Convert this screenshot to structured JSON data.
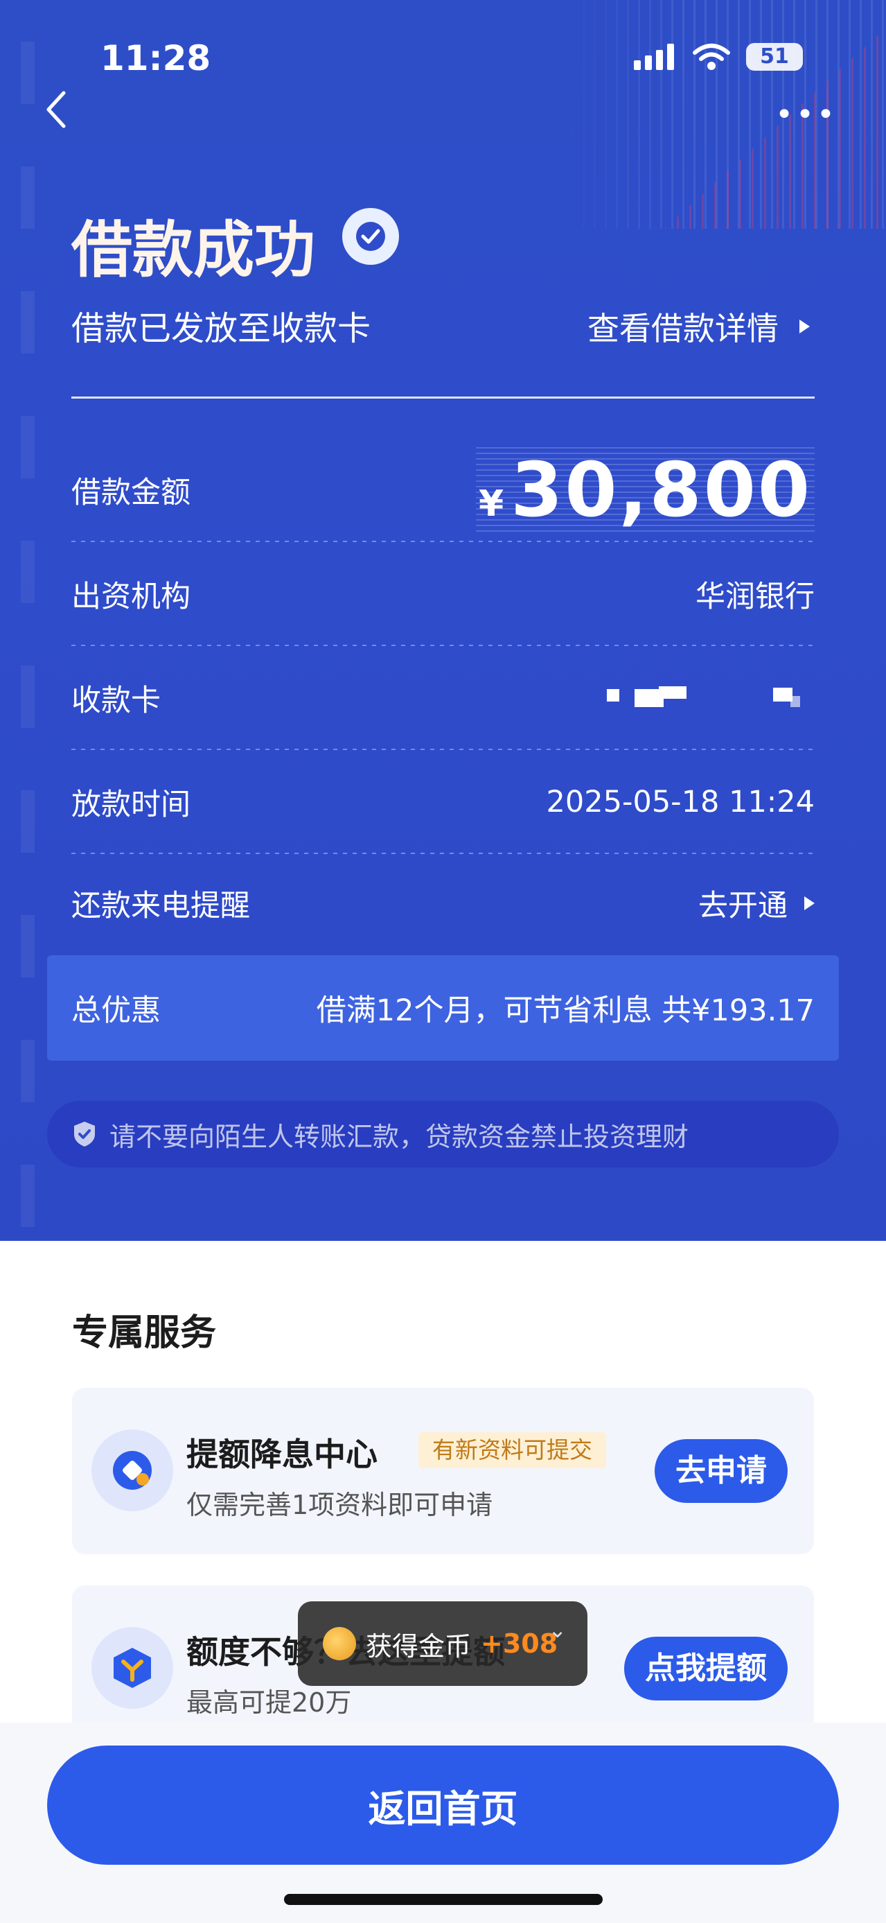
{
  "status_bar": {
    "time": "11:28",
    "battery": "51"
  },
  "header": {
    "title": "借款成功",
    "subtitle": "借款已发放至收款卡",
    "detail_link": "查看借款详情"
  },
  "loan": {
    "amount_label": "借款金额",
    "currency": "¥",
    "amount": "30,800",
    "institution_label": "出资机构",
    "institution": "华润银行",
    "card_label": "收款卡",
    "time_label": "放款时间",
    "time": "2025-05-18 11:24",
    "reminder_label": "还款来电提醒",
    "reminder_action": "去开通"
  },
  "discount": {
    "label": "总优惠",
    "text": "借满12个月，可节省利息 共¥193.17"
  },
  "warning": "请不要向陌生人转账汇款，贷款资金禁止投资理财",
  "services": {
    "title": "专属服务",
    "items": [
      {
        "name": "提额降息中心",
        "badge": "有新资料可提交",
        "desc": "仅需完善1项资料即可申请",
        "button": "去申请"
      },
      {
        "name": "额度不够？去这里提额",
        "desc": "最高可提20万",
        "button": "点我提额"
      }
    ]
  },
  "toast": {
    "text": "获得金币",
    "plus": "+308"
  },
  "home_button": "返回首页",
  "colors": {
    "primary": "#2c5bea",
    "hero": "#2e4ec7",
    "badge_text": "#c07a18",
    "toast_highlight": "#ff8a1e"
  }
}
